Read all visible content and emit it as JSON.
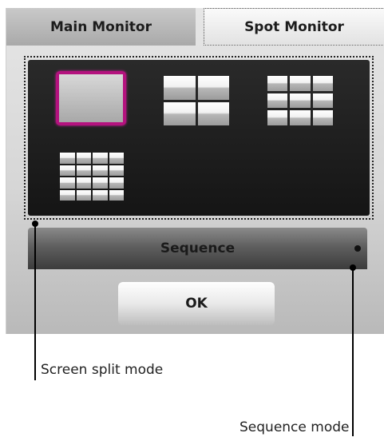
{
  "tabs": {
    "main_monitor": "Main Monitor",
    "spot_monitor": "Spot Monitor"
  },
  "split_modes": {
    "options": [
      "1 screen",
      "4 screen split",
      "9 screen split",
      "16 screen split"
    ],
    "selected": "1 screen",
    "selection_color": "#b4127e"
  },
  "sequence": {
    "label": "Sequence"
  },
  "ok_button": {
    "label": "OK"
  },
  "callouts": {
    "split_mode": "Screen split mode",
    "sequence_mode": "Sequence mode"
  }
}
